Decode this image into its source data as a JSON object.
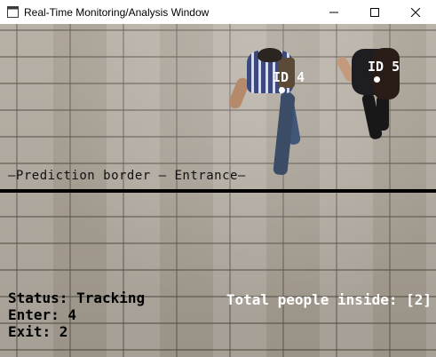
{
  "window": {
    "title": "Real-Time Monitoring/Analysis Window",
    "controls": [
      "minimize",
      "maximize",
      "close"
    ]
  },
  "video": {
    "tracks": [
      {
        "label": "ID 4"
      },
      {
        "label": "ID 5"
      }
    ],
    "prediction_border_label": "—Prediction border — Entrance—",
    "status_line": "Status: Tracking",
    "enter_line": "Enter: 4",
    "exit_line": "Exit: 2",
    "total_line": "Total people inside: [2]"
  },
  "colors": {
    "overlay_text_light": "#ffffff",
    "overlay_text_dark": "#000000",
    "border_line": "#000000"
  }
}
